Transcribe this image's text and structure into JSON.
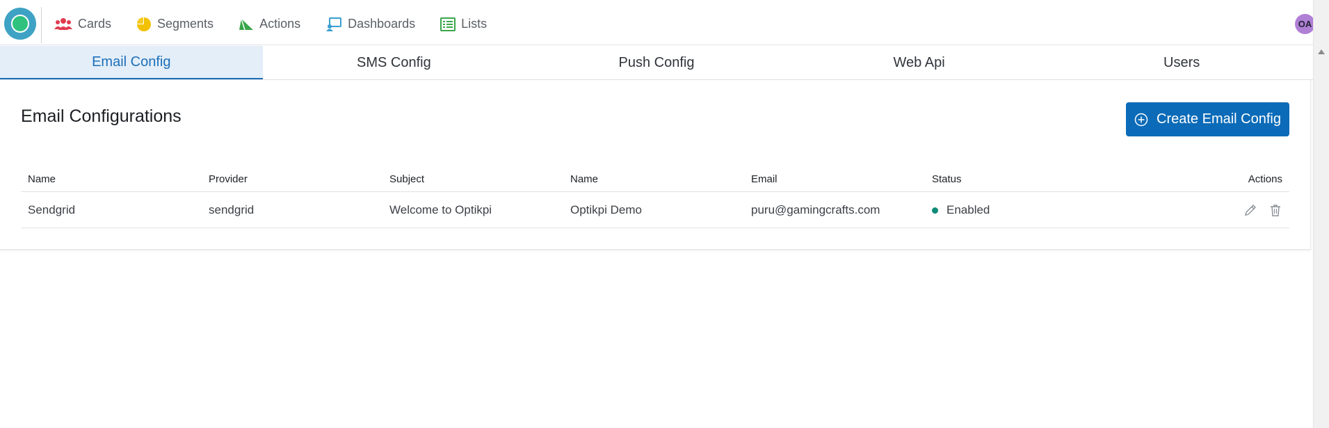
{
  "topbar": {
    "nav": [
      {
        "label": "Cards",
        "icon": "users-icon",
        "color": "#e03b4f"
      },
      {
        "label": "Segments",
        "icon": "pie-chart-icon",
        "color": "#f2c100"
      },
      {
        "label": "Actions",
        "icon": "send-icon",
        "color": "#3aa64a"
      },
      {
        "label": "Dashboards",
        "icon": "dashboard-icon",
        "color": "#3a9fd1"
      },
      {
        "label": "Lists",
        "icon": "list-icon",
        "color": "#3aa64a"
      }
    ],
    "avatar_initials": "OA"
  },
  "tabs": [
    {
      "label": "Email Config",
      "active": true
    },
    {
      "label": "SMS Config",
      "active": false
    },
    {
      "label": "Push Config",
      "active": false
    },
    {
      "label": "Web Api",
      "active": false
    },
    {
      "label": "Users",
      "active": false
    }
  ],
  "card": {
    "title": "Email Configurations",
    "create_button_label": "Create Email Config"
  },
  "table": {
    "headers": [
      "Name",
      "Provider",
      "Subject",
      "Name",
      "Email",
      "Status",
      "Actions"
    ],
    "rows": [
      {
        "name": "Sendgrid",
        "provider": "sendgrid",
        "subject": "Welcome to Optikpi",
        "from_name": "Optikpi Demo",
        "email": "puru@gamingcrafts.com",
        "status": "Enabled"
      }
    ]
  },
  "colors": {
    "accent": "#0b6bb8",
    "status_enabled": "#0e8a78"
  }
}
